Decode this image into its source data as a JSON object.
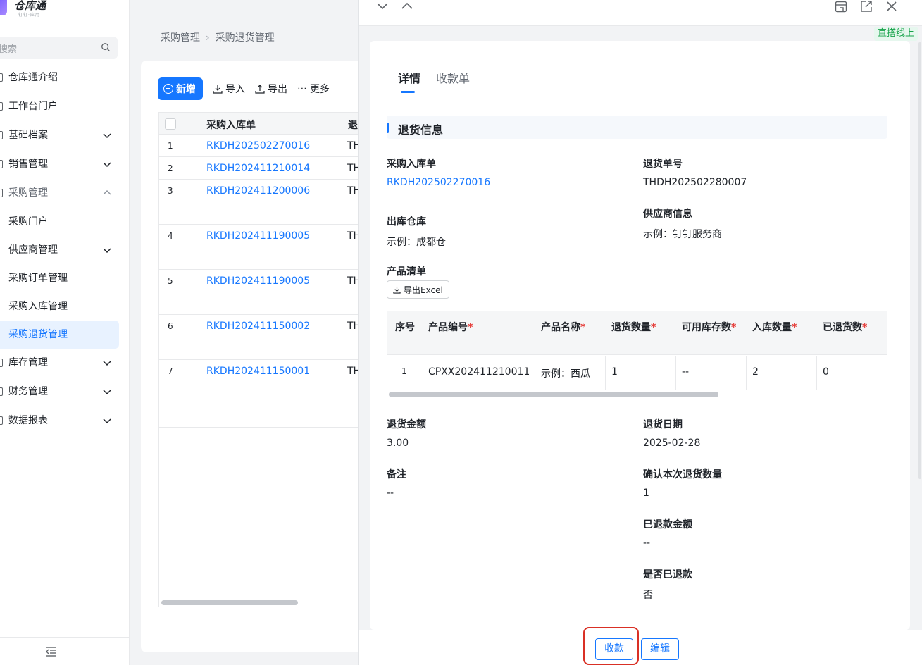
{
  "app": {
    "title": "仓库通",
    "subtitle": "钉钉·应用"
  },
  "sidebar": {
    "search_placeholder": "搜索",
    "menu": [
      {
        "label": "仓库通介绍",
        "chevron": ""
      },
      {
        "label": "工作台门户",
        "chevron": ""
      },
      {
        "label": "基础档案",
        "chevron": "down"
      },
      {
        "label": "销售管理",
        "chevron": "down"
      },
      {
        "label": "采购管理",
        "chevron": "up"
      },
      {
        "label": "采购门户",
        "chevron": ""
      },
      {
        "label": "供应商管理",
        "chevron": "down"
      },
      {
        "label": "采购订单管理",
        "chevron": ""
      },
      {
        "label": "采购入库管理",
        "chevron": ""
      },
      {
        "label": "采购退货管理",
        "chevron": ""
      },
      {
        "label": "库存管理",
        "chevron": "down"
      },
      {
        "label": "财务管理",
        "chevron": "down"
      },
      {
        "label": "数据报表",
        "chevron": "down"
      }
    ]
  },
  "breadcrumb": {
    "parent": "采购管理",
    "current": "采购退货管理"
  },
  "toolbar": {
    "add": "新增",
    "import": "导入",
    "export": "导出",
    "more": "更多"
  },
  "list": {
    "columns": [
      "采购入库单",
      "退"
    ],
    "rows": [
      {
        "idx": "1",
        "code": "RKDH202502270016",
        "col2": "TH"
      },
      {
        "idx": "2",
        "code": "RKDH202411210014",
        "col2": "TH"
      },
      {
        "idx": "3",
        "code": "RKDH202411200006",
        "col2": "TH"
      },
      {
        "idx": "4",
        "code": "RKDH202411190005",
        "col2": "TH"
      },
      {
        "idx": "5",
        "code": "RKDH202411190005",
        "col2": "TH"
      },
      {
        "idx": "6",
        "code": "RKDH202411150002",
        "col2": "TH"
      },
      {
        "idx": "7",
        "code": "RKDH202411150001",
        "col2": "TH"
      }
    ]
  },
  "drawer": {
    "env_badge": "直搭线上",
    "tabs": [
      "详情",
      "收款单"
    ],
    "section_title": "退货信息",
    "fields": {
      "purchase_in_label": "采购入库单",
      "purchase_in_value": "RKDH202502270016",
      "return_no_label": "退货单号",
      "return_no_value": "THDH202502280007",
      "warehouse_label": "出库仓库",
      "warehouse_value": "示例：成都仓",
      "supplier_label": "供应商信息",
      "supplier_value": "示例：钉钉服务商",
      "product_list_label": "产品清单",
      "export_excel": "导出Excel",
      "amount_label": "退货金额",
      "amount_value": "3.00",
      "date_label": "退货日期",
      "date_value": "2025-02-28",
      "remark_label": "备注",
      "remark_value": "--",
      "confirm_qty_label": "确认本次退货数量",
      "confirm_qty_value": "1",
      "refunded_amount_label": "已退款金额",
      "refunded_amount_value": "--",
      "is_refunded_label": "是否已退款",
      "is_refunded_value": "否"
    },
    "product_table": {
      "headers": [
        "序号",
        "产品编号",
        "产品名称",
        "退货数量",
        "可用库存数",
        "入库数量",
        "已退货数"
      ],
      "required_mark": "*",
      "row": {
        "seq": "1",
        "code": "CPXX202411210011",
        "name": "示例：西瓜",
        "return_qty": "1",
        "stock": "--",
        "in_qty": "2",
        "returned": "0"
      }
    },
    "footer": {
      "collect": "收款",
      "edit": "编辑"
    }
  },
  "colors": {
    "primary": "#1677ff",
    "highlight": "#d93025",
    "badge_green": "#16a34a"
  }
}
